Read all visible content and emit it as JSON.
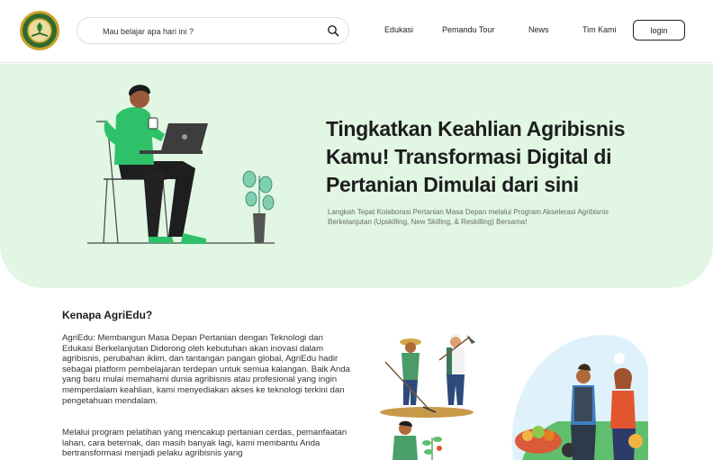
{
  "navbar": {
    "search": {
      "placeholder": "Mau belajar apa hari ini ?"
    },
    "links": [
      "Edukasi",
      "Pemandu Tour",
      "News",
      "Tim Kami"
    ],
    "login_label": "login"
  },
  "hero": {
    "title": "Tingkatkan Keahlian Agribisnis Kamu! Transformasi Digital di Pertanian Dimulai dari sini",
    "subtitle": "Langkah Tepat Kolaborasi Pertanian Masa Depan melalui Program Akselerasi Agribisnis Berkelanjutan (Upskilling, New Skilling, & Reskilling) Bersama!"
  },
  "about": {
    "title": "Kenapa AgriEdu?",
    "paragraph1": "AgriEdu: Membangun Masa Depan Pertanian dengan Teknologi dan Edukasi Berkelanjutan Didorong oleh kebutuhan akan inovasi dalam agribisnis, perubahan iklim, dan tantangan pangan global, AgriEdu hadir sebagai platform pembelajaran terdepan untuk semua kalangan. Baik Anda yang baru mulai memahami dunia agribisnis atau profesional yang ingin memperdalam keahlian, kami menyediakan akses ke teknologi terkini dan pengetahuan mendalam.",
    "paragraph2": "Melalui program pelatihan yang mencakup pertanian cerdas, pemanfaatan lahan, cara beternak, dan masih banyak lagi, kami membantu Anda bertransformasi menjadi pelaku agribisnis yang"
  },
  "colors": {
    "hero_bg": "#e1f7e4",
    "accent_green": "#2ec16a"
  }
}
